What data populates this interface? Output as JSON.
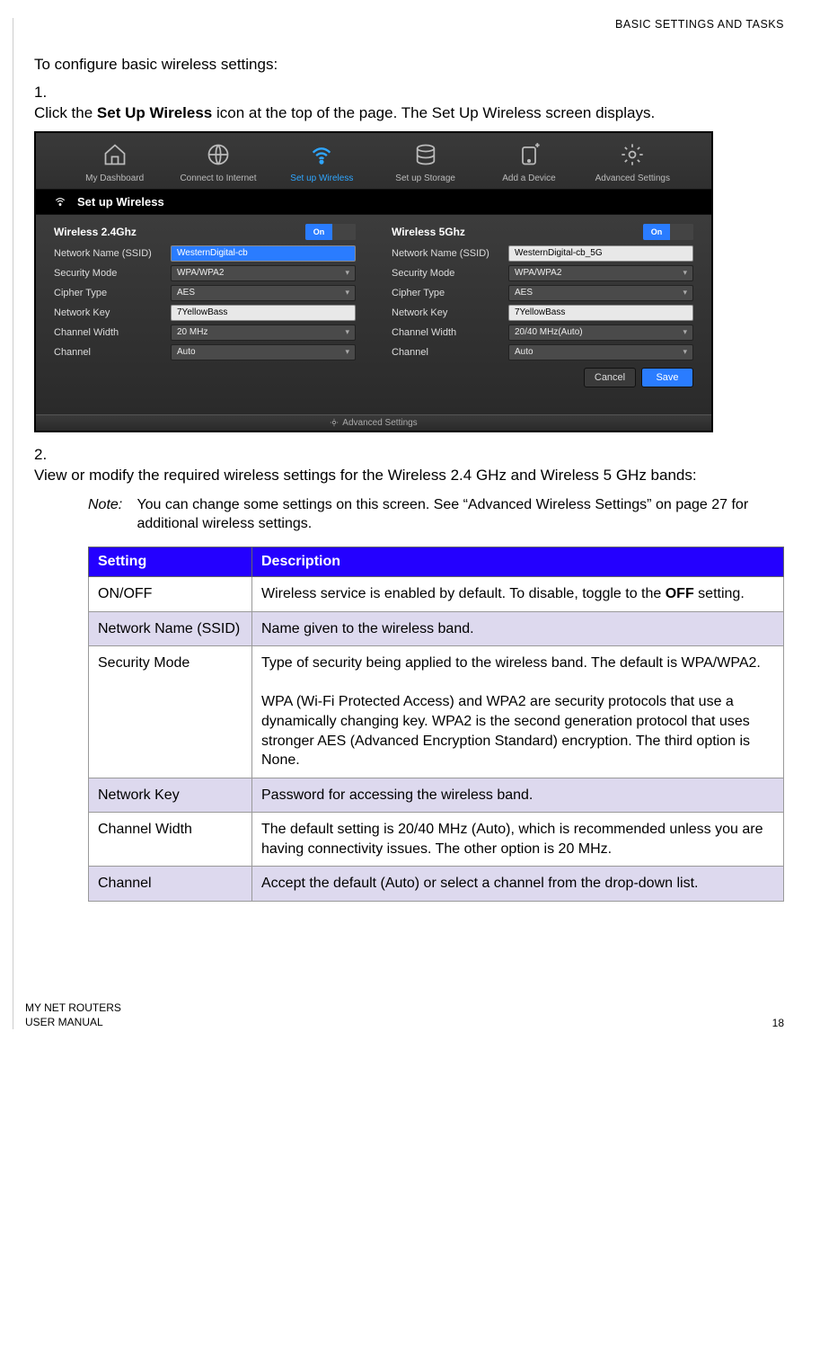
{
  "header": {
    "section": "BASIC SETTINGS AND TASKS"
  },
  "intro": "To configure basic wireless settings:",
  "steps": {
    "s1_num": "1.",
    "s1_pre": "Click the ",
    "s1_bold": "Set Up Wireless",
    "s1_post": " icon at the top of the page. The Set Up Wireless screen displays.",
    "s2_num": "2.",
    "s2_text": "View or modify the required wireless settings for the Wireless 2.4 GHz and Wireless 5 GHz bands:"
  },
  "note": {
    "label": "Note:",
    "text": "You can change some settings on this screen. See “Advanced Wireless Settings” on page 27 for additional wireless settings."
  },
  "shot": {
    "nav": {
      "dashboard": "My Dashboard",
      "connect": "Connect to Internet",
      "wireless": "Set up Wireless",
      "storage": "Set up Storage",
      "device": "Add a Device",
      "advanced": "Advanced Settings"
    },
    "subhead": "Set up Wireless",
    "on_label": "On",
    "col24": {
      "title": "Wireless 2.4Ghz",
      "ssid_label": "Network Name (SSID)",
      "ssid_value": "WesternDigital-cb",
      "security_label": "Security Mode",
      "security_value": "WPA/WPA2",
      "cipher_label": "Cipher Type",
      "cipher_value": "AES",
      "key_label": "Network Key",
      "key_value": "7YellowBass",
      "width_label": "Channel Width",
      "width_value": "20 MHz",
      "channel_label": "Channel",
      "channel_value": "Auto"
    },
    "col5": {
      "title": "Wireless 5Ghz",
      "ssid_label": "Network Name (SSID)",
      "ssid_value": "WesternDigital-cb_5G",
      "security_label": "Security Mode",
      "security_value": "WPA/WPA2",
      "cipher_label": "Cipher Type",
      "cipher_value": "AES",
      "key_label": "Network Key",
      "key_value": "7YellowBass",
      "width_label": "Channel Width",
      "width_value": "20/40 MHz(Auto)",
      "channel_label": "Channel",
      "channel_value": "Auto"
    },
    "cancel": "Cancel",
    "save": "Save",
    "advanced_bar": "Advanced Settings"
  },
  "table": {
    "h1": "Setting",
    "h2": "Description",
    "rows": [
      {
        "s": "ON/OFF",
        "d_pre": "Wireless service is enabled by default. To disable, toggle to the ",
        "d_bold": "OFF",
        "d_post": " setting."
      },
      {
        "s": "Network Name (SSID)",
        "d": "Name given to the wireless band."
      },
      {
        "s": "Security Mode",
        "d": "Type of security being applied to the wireless band. The default is WPA/WPA2.\n\nWPA (Wi-Fi Protected Access) and WPA2 are security protocols that use a dynamically changing key. WPA2 is the second generation protocol that uses stronger AES (Advanced Encryption Standard) encryption. The third option is None."
      },
      {
        "s": "Network Key",
        "d": "Password for accessing the wireless band."
      },
      {
        "s": "Channel Width",
        "d": "The default setting is 20/40 MHz (Auto), which is recommended unless you are having connectivity issues. The other option is 20 MHz."
      },
      {
        "s": "Channel",
        "d": "Accept the default (Auto) or select a channel from the drop-down list."
      }
    ]
  },
  "footer": {
    "line1": "MY NET ROUTERS",
    "line2": "USER MANUAL",
    "page": "18"
  }
}
